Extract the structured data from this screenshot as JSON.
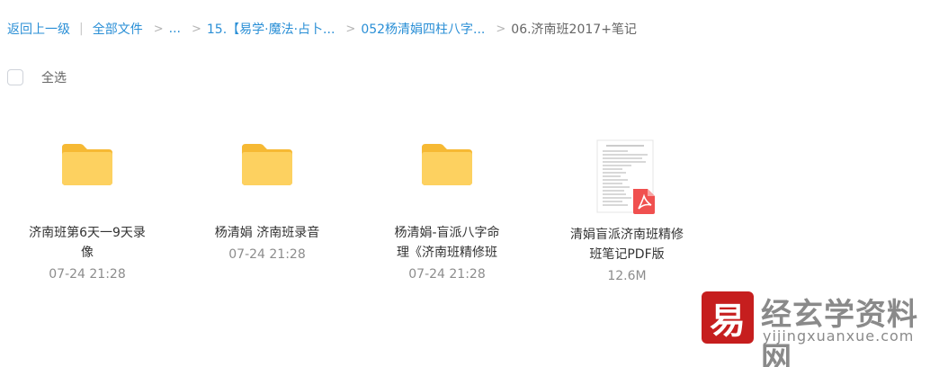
{
  "breadcrumb": {
    "back": "返回上一级",
    "all_files": "全部文件",
    "ellipsis": "...",
    "level1": "15.【易学·魔法·占卜...",
    "level2": "052杨清娟四柱八字...",
    "current": "06.济南班2017+笔记"
  },
  "select_all": {
    "label": "全选"
  },
  "files": [
    {
      "icon": "folder-icon",
      "name": "济南班第6天一9天录像",
      "meta": "07-24 21:28"
    },
    {
      "icon": "folder-icon",
      "name": "杨清娟 济南班录音",
      "meta": "07-24 21:28"
    },
    {
      "icon": "folder-icon",
      "name": "杨清娟-盲派八字命理《济南班精修班",
      "meta": "07-24 21:28"
    },
    {
      "icon": "pdf-file-icon",
      "name": "清娟盲派济南班精修班笔记PDF版",
      "meta": "12.6M"
    }
  ],
  "watermark": {
    "logo_char": "易",
    "title": "经玄学资料网",
    "subtitle": "yijingxuanxue.com"
  },
  "colors": {
    "link": "#2a8fd6",
    "folder": "#f8c54b",
    "pdf_badge": "#f0504f",
    "watermark_red": "#c61e1e"
  }
}
